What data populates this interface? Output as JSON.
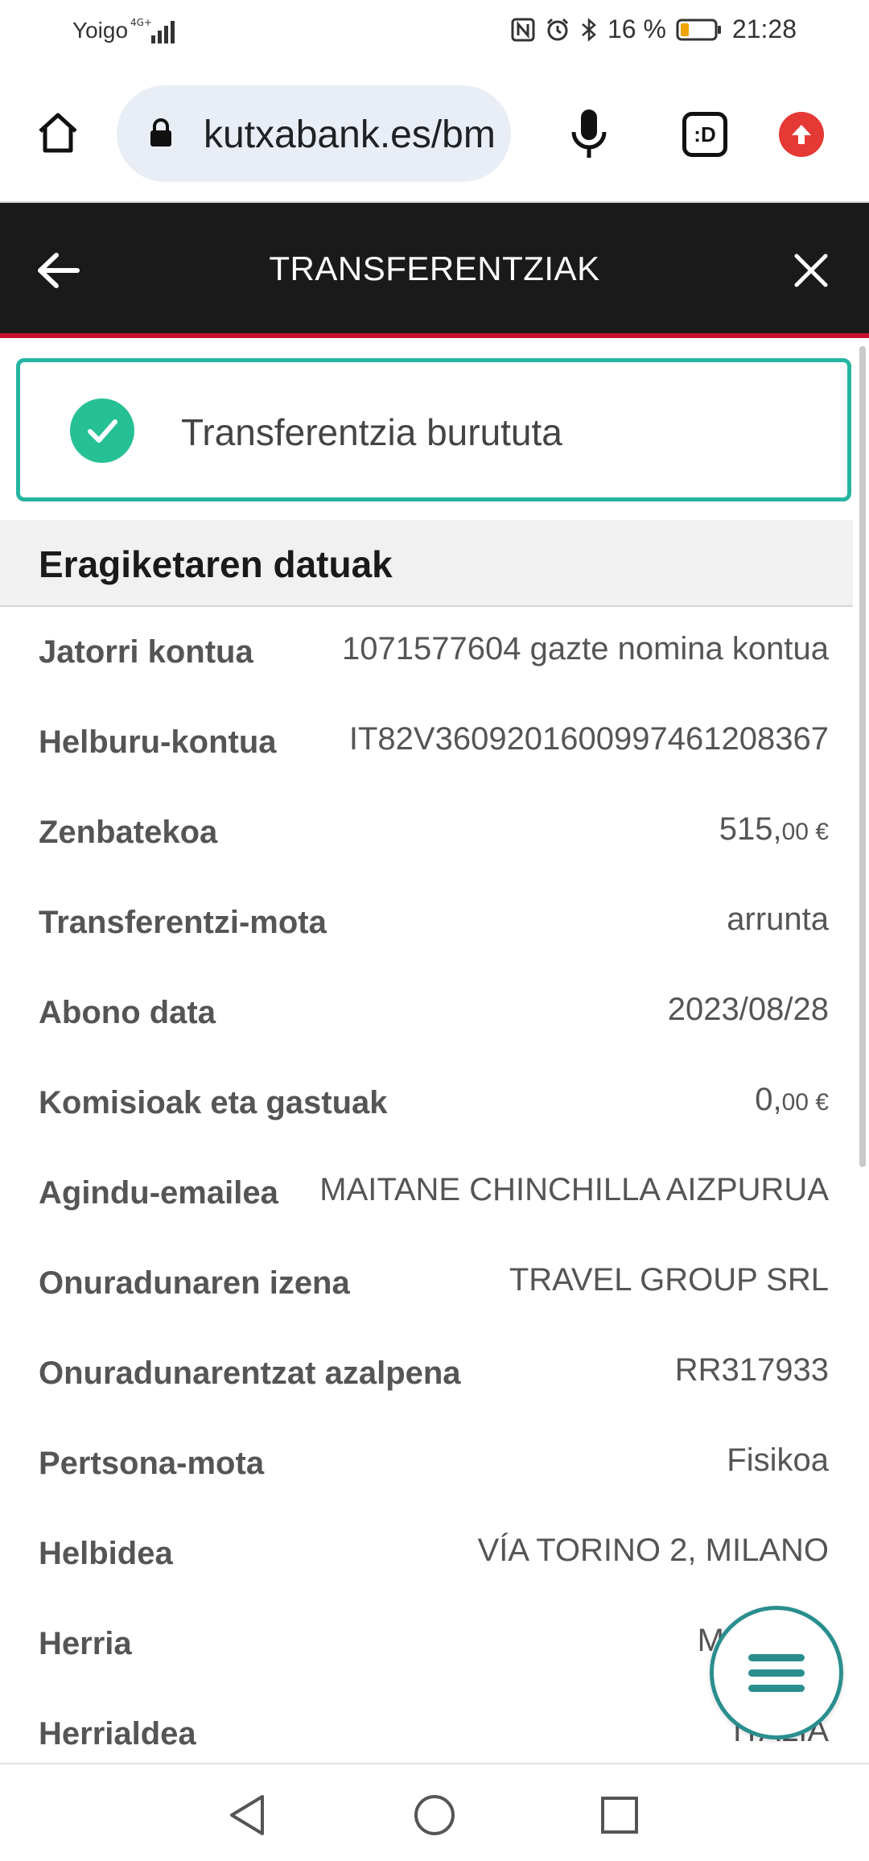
{
  "status_bar": {
    "carrier": "Yoigo",
    "network": "4G+",
    "battery_percent": "16 %",
    "time": "21:28"
  },
  "browser": {
    "url": "kutxabank.es/bm",
    "extension_label": ":D"
  },
  "header": {
    "title": "TRANSFERENTZIAK"
  },
  "success": {
    "message": "Transferentzia burututa"
  },
  "section": {
    "title": "Eragiketaren datuak"
  },
  "rows": [
    {
      "label": "Jatorri kontua",
      "value": "1071577604 gazte nomina kontua"
    },
    {
      "label": "Helburu-kontua",
      "value": "IT82V3609201600997461208367"
    },
    {
      "label": "Zenbatekoa",
      "value_int": "515,",
      "value_dec": "00 €"
    },
    {
      "label": "Transferentzi-mota",
      "value": "arrunta"
    },
    {
      "label": "Abono data",
      "value": "2023/08/28"
    },
    {
      "label": "Komisioak eta gastuak",
      "value_int": "0,",
      "value_dec": "00 €"
    },
    {
      "label": "Agindu-emailea",
      "value": "MAITANE CHINCHILLA AIZPURUA"
    },
    {
      "label": "Onuradunaren izena",
      "value": "TRAVEL GROUP SRL"
    },
    {
      "label": "Onuradunarentzat azalpena",
      "value": "RR317933"
    },
    {
      "label": "Pertsona-mota",
      "value": "Fisikoa"
    },
    {
      "label": "Helbidea",
      "value": "VÍA TORINO 2, MILANO"
    },
    {
      "label": "Herria",
      "value": "M"
    },
    {
      "label": "Herrialdea",
      "value": "ITALIA"
    }
  ],
  "colors": {
    "header_bg": "#1a1a1a",
    "header_accent": "#c8102e",
    "success_border": "#26b5a0",
    "success_icon": "#26c095",
    "fab_accent": "#2a8e8e"
  },
  "icons": [
    "home-icon",
    "lock-icon",
    "mic-icon",
    "extension-icon",
    "update-icon",
    "back-arrow-icon",
    "close-icon",
    "check-icon",
    "menu-icon",
    "nav-back-icon",
    "nav-home-icon",
    "nav-recents-icon"
  ]
}
